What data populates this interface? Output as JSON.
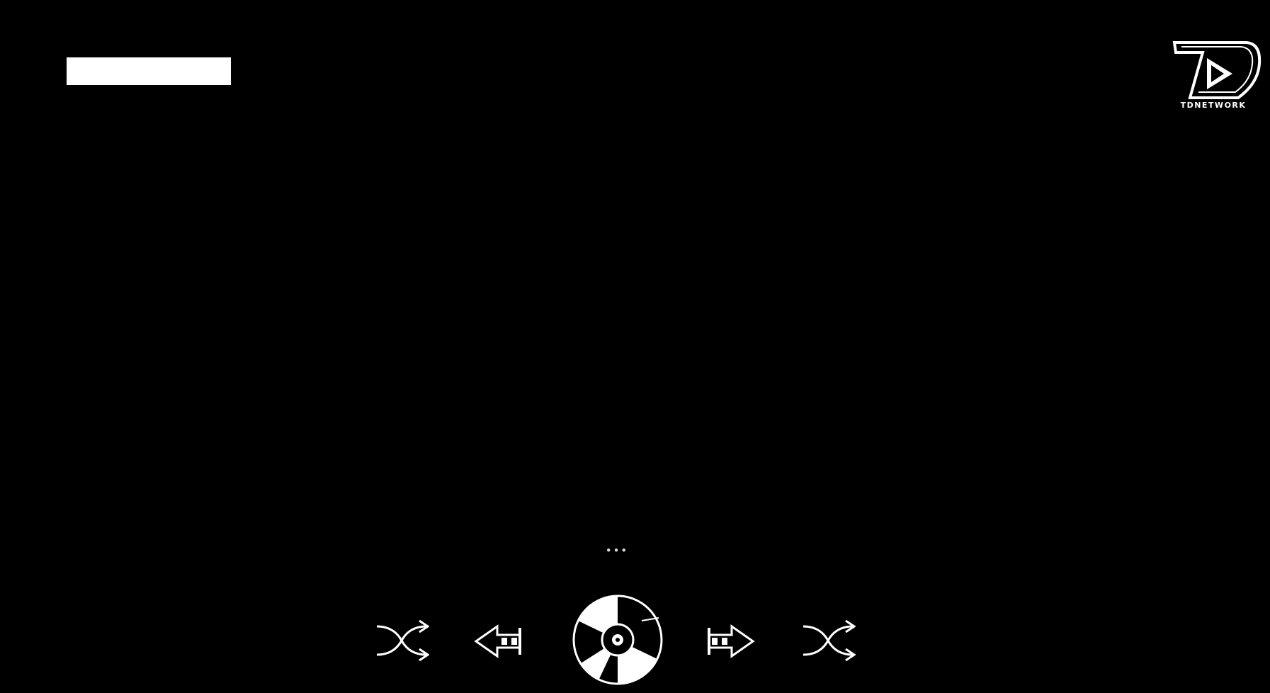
{
  "header": {
    "title_box_text": ""
  },
  "logo": {
    "text": "TDNETWORK"
  },
  "player": {
    "now_playing": "..."
  },
  "controls": {
    "shuffle_left": {
      "icon": "shuffle-icon"
    },
    "prev": {
      "icon": "previous-icon"
    },
    "play": {
      "icon": "disc-play-icon"
    },
    "next": {
      "icon": "next-icon"
    },
    "shuffle_right": {
      "icon": "shuffle-icon"
    }
  },
  "colors": {
    "background": "#000000",
    "foreground": "#ffffff"
  }
}
